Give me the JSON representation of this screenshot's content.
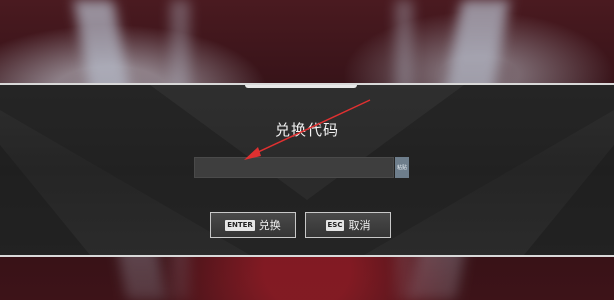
{
  "dialog": {
    "title": "兑换代码",
    "input": {
      "value": "",
      "placeholder": ""
    },
    "paste_label": "粘贴"
  },
  "buttons": {
    "confirm": {
      "key": "ENTER",
      "label": "兑换"
    },
    "cancel": {
      "key": "ESC",
      "label": "取消"
    }
  },
  "colors": {
    "dialog_bg": "#2b2b2b",
    "border": "#d9d9d9",
    "arrow": "#e03030",
    "paste_button": "#6e7e8c"
  }
}
